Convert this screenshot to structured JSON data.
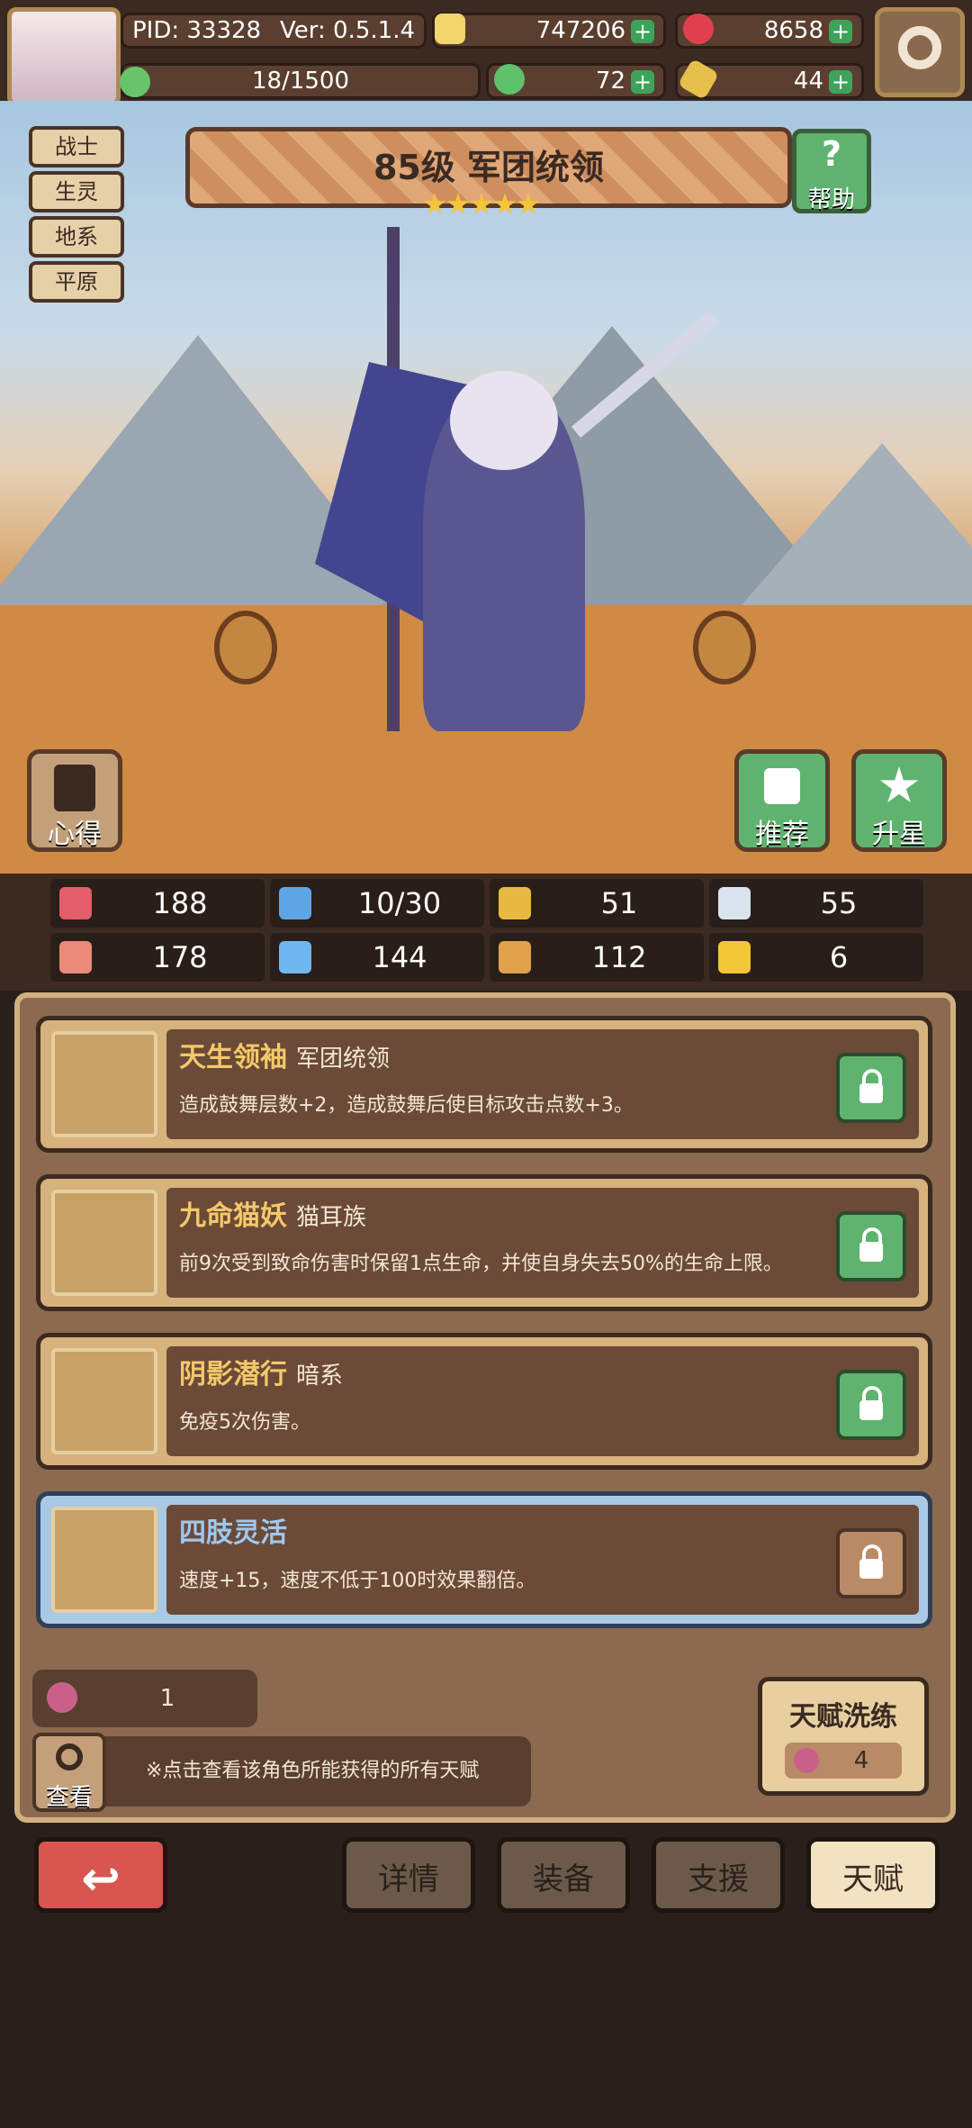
{
  "header": {
    "pid": "PID: 33328",
    "version": "Ver: 0.5.1.4",
    "gold": "747206",
    "ruby": "8658",
    "exp": "18/1500",
    "clover": "72",
    "key": "44"
  },
  "hero": {
    "tags": [
      "战士",
      "生灵",
      "地系",
      "平原"
    ],
    "title": "85级  军团统领",
    "stars": 5,
    "help_label": "帮助",
    "notes_label": "心得",
    "recommend_label": "推荐",
    "upgrade_label": "升星"
  },
  "stats": [
    {
      "icon": "heart-icon",
      "value": "188",
      "color": "#e35d6a"
    },
    {
      "icon": "mana-drop-icon",
      "value": "10/30",
      "color": "#5fa5e6"
    },
    {
      "icon": "shield-icon",
      "value": "51",
      "color": "#e8b940"
    },
    {
      "icon": "wing-icon",
      "value": "55",
      "color": "#d9e4ef"
    },
    {
      "icon": "fist-icon",
      "value": "178",
      "color": "#e98a7a"
    },
    {
      "icon": "book-icon",
      "value": "144",
      "color": "#6fb7ef"
    },
    {
      "icon": "scroll-icon",
      "value": "112",
      "color": "#e0a14a"
    },
    {
      "icon": "horseshoe-icon",
      "value": "6",
      "color": "#f1c637"
    }
  ],
  "talents": [
    {
      "name": "天生领袖",
      "sub": "军团统领",
      "desc": "造成鼓舞层数+2，造成鼓舞后使目标攻击点数+3。",
      "icon": "star-icon",
      "locked": true
    },
    {
      "name": "九命猫妖",
      "sub": "猫耳族",
      "desc": "前9次受到致命伤害时保留1点生命，并使自身失去50%的生命上限。",
      "icon": "cat-icon",
      "locked": true
    },
    {
      "name": "阴影潜行",
      "sub": "暗系",
      "desc": "免疫5次伤害。",
      "icon": "moon-icon",
      "locked": true
    },
    {
      "name": "四肢灵活",
      "sub": "",
      "desc": "速度+15，速度不低于100时效果翻倍。",
      "icon": "cross-icon",
      "locked": false
    }
  ],
  "inventory": {
    "fruit_count": "1",
    "view_label": "查看",
    "hint": "※点击查看该角色所能获得的所有天赋",
    "reroll_label": "天赋洗练",
    "reroll_cost": "4"
  },
  "tabs": [
    "详情",
    "装备",
    "支援",
    "天赋"
  ],
  "active_tab": "天赋"
}
